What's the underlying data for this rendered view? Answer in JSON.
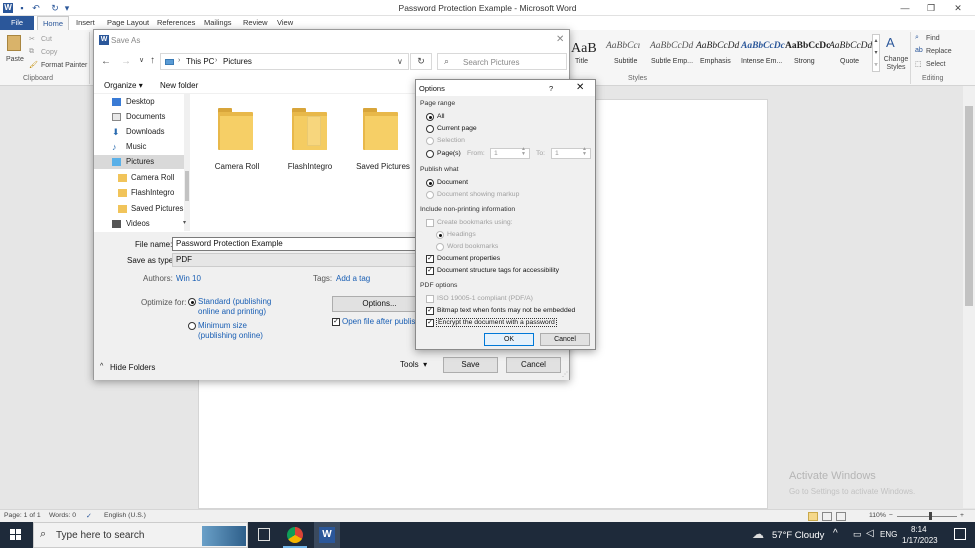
{
  "word": {
    "title": "Password Protection Example - Microsoft Word",
    "tabs": [
      "File",
      "Home",
      "Insert",
      "Page Layout",
      "References",
      "Mailings",
      "Review",
      "View"
    ],
    "clipboard": {
      "paste": "Paste",
      "cut": "Cut",
      "copy": "Copy",
      "format_painter": "Format Painter",
      "group": "Clipboard"
    },
    "styles": [
      {
        "sample": "AaB",
        "name": "Title"
      },
      {
        "sample": "AaBbCcı",
        "name": "Subtitle"
      },
      {
        "sample": "AaBbCcDd",
        "name": "Subtle Emp..."
      },
      {
        "sample": "AaBbCcDd",
        "name": "Emphasis"
      },
      {
        "sample": "AaBbCcDc",
        "name": "Intense Em..."
      },
      {
        "sample": "AaBbCcDc",
        "name": "Strong"
      },
      {
        "sample": "AaBbCcDd",
        "name": "Quote"
      }
    ],
    "styles_group": "Styles",
    "change_styles": "Change Styles",
    "editing": {
      "find": "Find",
      "replace": "Replace",
      "select": "Select",
      "group": "Editing"
    },
    "watermark_title": "Activate Windows",
    "watermark_sub": "Go to Settings to activate Windows.",
    "status": {
      "page": "Page: 1 of 1",
      "words": "Words: 0",
      "language": "English (U.S.)",
      "zoom": "110%"
    }
  },
  "taskbar": {
    "search_placeholder": "Type here to search",
    "weather": "57°F Cloudy",
    "lang": "ENG",
    "time": "8:14",
    "date": "1/17/2023"
  },
  "save_as": {
    "title": "Save As",
    "breadcrumb": [
      "This PC",
      "Pictures"
    ],
    "search_placeholder": "Search Pictures",
    "organize": "Organize",
    "new_folder": "New folder",
    "nav_items": [
      "Desktop",
      "Documents",
      "Downloads",
      "Music",
      "Pictures",
      "Camera Roll",
      "FlashIntegro",
      "Saved Pictures",
      "Videos"
    ],
    "folders": [
      "Camera Roll",
      "FlashIntegro",
      "Saved Pictures"
    ],
    "file_name_label": "File name:",
    "file_name_value": "Password Protection Example",
    "save_type_label": "Save as type:",
    "save_type_value": "PDF",
    "authors_label": "Authors:",
    "authors_value": "Win 10",
    "tags_label": "Tags:",
    "tags_value": "Add a tag",
    "optimize_label": "Optimize for:",
    "opt_standard_1": "Standard (publishing",
    "opt_standard_2": "online and printing)",
    "opt_minimum_1": "Minimum size",
    "opt_minimum_2": "(publishing online)",
    "options_button": "Options...",
    "open_after": "Open file after publishing",
    "hide_folders": "Hide Folders",
    "tools": "Tools",
    "save": "Save",
    "cancel": "Cancel"
  },
  "options": {
    "title": "Options",
    "help": "?",
    "page_range": "Page range",
    "all": "All",
    "current_page": "Current page",
    "selection": "Selection",
    "pages": "Page(s)",
    "from": "From:",
    "from_value": "1",
    "to": "To:",
    "to_value": "1",
    "publish_what": "Publish what",
    "document": "Document",
    "document_markup": "Document showing markup",
    "nonprinting": "Include non-printing information",
    "create_bookmarks": "Create bookmarks using:",
    "headings": "Headings",
    "word_bookmarks": "Word bookmarks",
    "doc_properties": "Document properties",
    "doc_structure": "Document structure tags for accessibility",
    "pdf_options": "PDF options",
    "iso": "ISO 19005-1 compliant (PDF/A)",
    "bitmap": "Bitmap text when fonts may not be embedded",
    "encrypt": "Encrypt the document with a password",
    "ok": "OK",
    "cancel": "Cancel"
  },
  "colors": {
    "word_blue": "#2b579a",
    "folder": "#f6cf66",
    "accent": "#0078d7"
  }
}
